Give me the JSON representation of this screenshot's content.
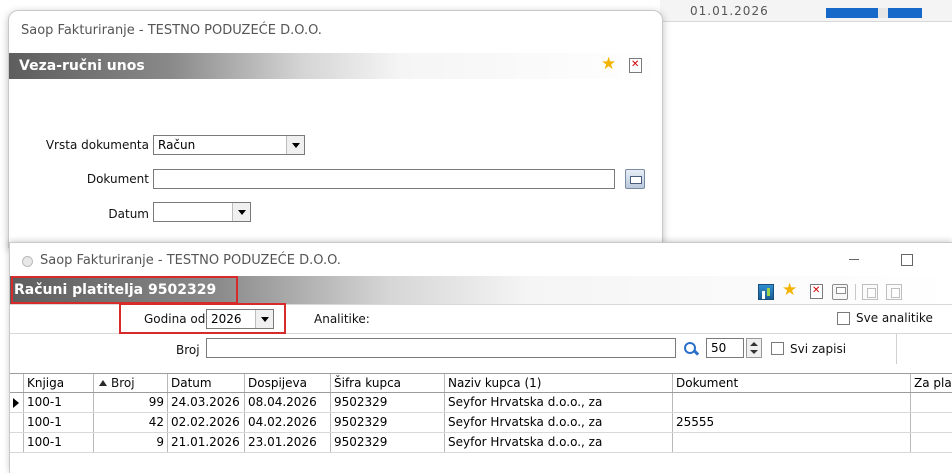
{
  "background": {
    "date_text": "01.01.2026"
  },
  "window1": {
    "title": "Saop Fakturiranje - TESTNO PODUZEĆE D.O.O.",
    "caption": "Veza-ručni unos",
    "form": {
      "vrsta_label": "Vrsta dokumenta",
      "vrsta_value": "Račun",
      "dokument_label": "Dokument",
      "dokument_value": "",
      "datum_label": "Datum",
      "datum_value": ""
    }
  },
  "window2": {
    "title": "Saop Fakturiranje - TESTNO PODUZEĆE D.O.O.",
    "caption": "Računi platitelja 9502329",
    "filter": {
      "godina_label": "Godina od",
      "godina_value": "2026",
      "analitike_label": "Analitike:",
      "sve_analitike_label": "Sve analitike"
    },
    "search": {
      "broj_label": "Broj",
      "broj_value": "",
      "limit_value": "50",
      "svi_zapisi_label": "Svi zapisi"
    },
    "grid": {
      "columns": [
        "Knjiga",
        "Broj",
        "Datum",
        "Dospijeva",
        "Šifra kupca",
        "Naziv kupca (1)",
        "Dokument",
        "Za plaćan"
      ],
      "rows": [
        {
          "knjiga": "100-1",
          "broj": "99",
          "datum": "24.03.2026",
          "dospijeva": "08.04.2026",
          "sifra": "9502329",
          "naziv": "Seyfor Hrvatska d.o.o., za",
          "dokument": ""
        },
        {
          "knjiga": "100-1",
          "broj": "42",
          "datum": "02.02.2026",
          "dospijeva": "04.02.2026",
          "sifra": "9502329",
          "naziv": "Seyfor Hrvatska d.o.o., za",
          "dokument": "25555"
        },
        {
          "knjiga": "100-1",
          "broj": "9",
          "datum": "21.01.2026",
          "dospijeva": "23.01.2026",
          "sifra": "9502329",
          "naziv": "Seyfor Hrvatska d.o.o., za",
          "dokument": ""
        }
      ]
    }
  },
  "colors": {
    "highlight_frame": "#d72b2b",
    "caption_dark": "#5d5d5d",
    "accent_blue": "#1769c9"
  },
  "icons": [
    "star-icon",
    "close-doc-icon",
    "lookup-icon",
    "dropdown-arrow-icon",
    "analytics-icon",
    "print-icon",
    "copy-icon",
    "search-icon",
    "sort-asc-icon",
    "row-pointer-icon",
    "minimize-icon",
    "maximize-icon"
  ]
}
